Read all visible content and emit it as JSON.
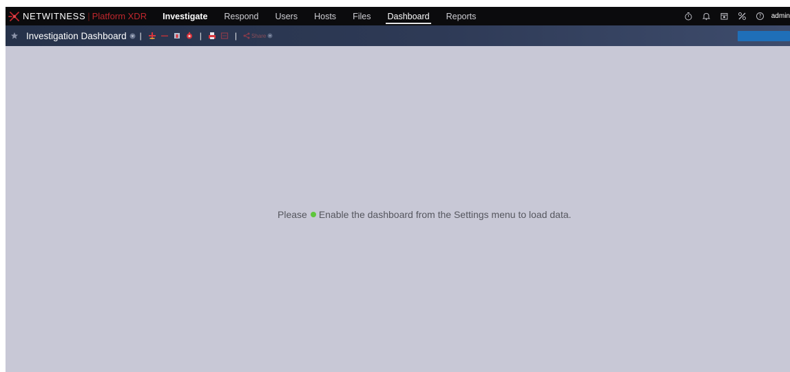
{
  "topnav": {
    "brand": "NETWITNESS",
    "brand_sep": "|",
    "product": "Platform XDR",
    "items": [
      {
        "label": "Investigate"
      },
      {
        "label": "Respond"
      },
      {
        "label": "Users"
      },
      {
        "label": "Hosts"
      },
      {
        "label": "Files"
      },
      {
        "label": "Dashboard"
      },
      {
        "label": "Reports"
      }
    ],
    "active": "Dashboard",
    "right_icons": [
      "timer-icon",
      "bell-icon",
      "calendar-icon",
      "tools-icon",
      "help-icon"
    ],
    "user": "admin"
  },
  "toolbar": {
    "title": "Investigation Dashboard",
    "sep": "|",
    "share_label": "Share",
    "icons": [
      "add-dashlet-icon",
      "remove-icon",
      "import-icon",
      "settings-icon",
      "print-icon",
      "export-icon",
      "share-icon"
    ]
  },
  "main": {
    "message_before": "Please",
    "message_after": "Enable the dashboard from the Settings menu to load data."
  },
  "colors": {
    "accent_red": "#c0272d",
    "status_green": "#5ec63c",
    "topbar": "#0b0b0d",
    "toolbar": "#2e3a56",
    "canvas": "#c8c8d6"
  }
}
